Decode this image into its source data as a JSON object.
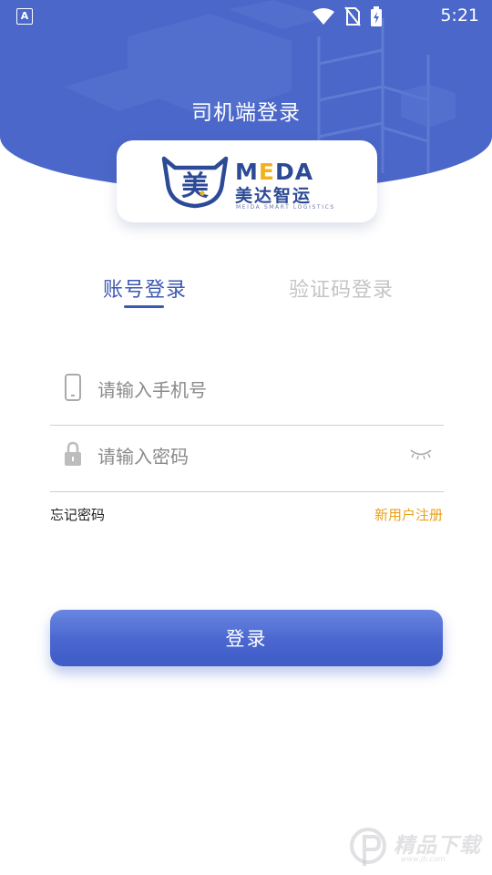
{
  "status_bar": {
    "app_badge": "A",
    "time": "5:21",
    "icons": [
      "wifi-icon",
      "no-sim-icon",
      "battery-charging-icon"
    ]
  },
  "page": {
    "title": "司机端登录"
  },
  "logo": {
    "brand_prefix": "M",
    "brand_accent": "E",
    "brand_suffix": "DA",
    "name_cn": "美达智运",
    "tagline": "MEIDA SMART LOGISTICS",
    "mark_char": "美"
  },
  "tabs": [
    {
      "label": "账号登录",
      "active": true
    },
    {
      "label": "验证码登录",
      "active": false
    }
  ],
  "form": {
    "phone": {
      "value": "",
      "placeholder": "请输入手机号",
      "icon": "phone-icon"
    },
    "password": {
      "value": "",
      "placeholder": "请输入密码",
      "icon": "lock-icon",
      "toggle_icon": "eye-closed-icon"
    }
  },
  "links": {
    "forgot": "忘记密码",
    "register": "新用户注册"
  },
  "login_button": {
    "label": "登录"
  },
  "watermark": {
    "text": "精品下载",
    "url": "www.jb.com"
  },
  "colors": {
    "primary": "#4a67c9",
    "accent": "#e8a21a",
    "tab_active": "#3d58b0",
    "tab_inactive": "#c4c4c4"
  }
}
